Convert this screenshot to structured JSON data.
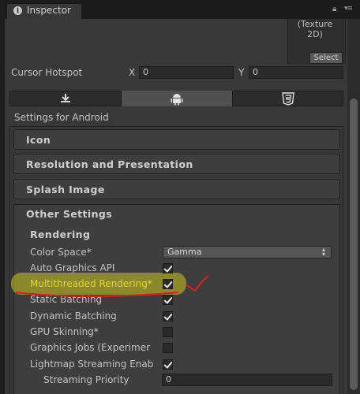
{
  "tab": {
    "title": "Inspector",
    "info_icon": "i"
  },
  "texture": {
    "label_line1": "(Texture",
    "label_line2": "2D)",
    "select_label": "Select"
  },
  "cursor_hotspot": {
    "label": "Cursor Hotspot",
    "x_label": "X",
    "x_value": "0",
    "y_label": "Y",
    "y_value": "0"
  },
  "platform_tabs": {
    "selected": "android",
    "items": [
      "download",
      "android",
      "html5"
    ]
  },
  "settings_for": "Settings for Android",
  "sections": {
    "icon": "Icon",
    "resolution": "Resolution and Presentation",
    "splash": "Splash Image",
    "other": "Other Settings"
  },
  "rendering": {
    "heading": "Rendering",
    "color_space_label": "Color Space*",
    "color_space_value": "Gamma",
    "rows": [
      {
        "label": "Auto Graphics API",
        "checked": true
      },
      {
        "label": "Multithreaded Rendering*",
        "checked": true
      },
      {
        "label": "Static Batching",
        "checked": true
      },
      {
        "label": "Dynamic Batching",
        "checked": true
      },
      {
        "label": "GPU Skinning*",
        "checked": false
      },
      {
        "label": "Graphics Jobs (Experimer",
        "checked": false
      },
      {
        "label": "Lightmap Streaming Enab",
        "checked": true
      }
    ],
    "streaming_priority_label": "Streaming Priority",
    "streaming_priority_value": "0"
  },
  "colors": {
    "highlight": "#c8c81e",
    "annotation": "#e01e1e",
    "highlight_text": "#e6d23a"
  }
}
